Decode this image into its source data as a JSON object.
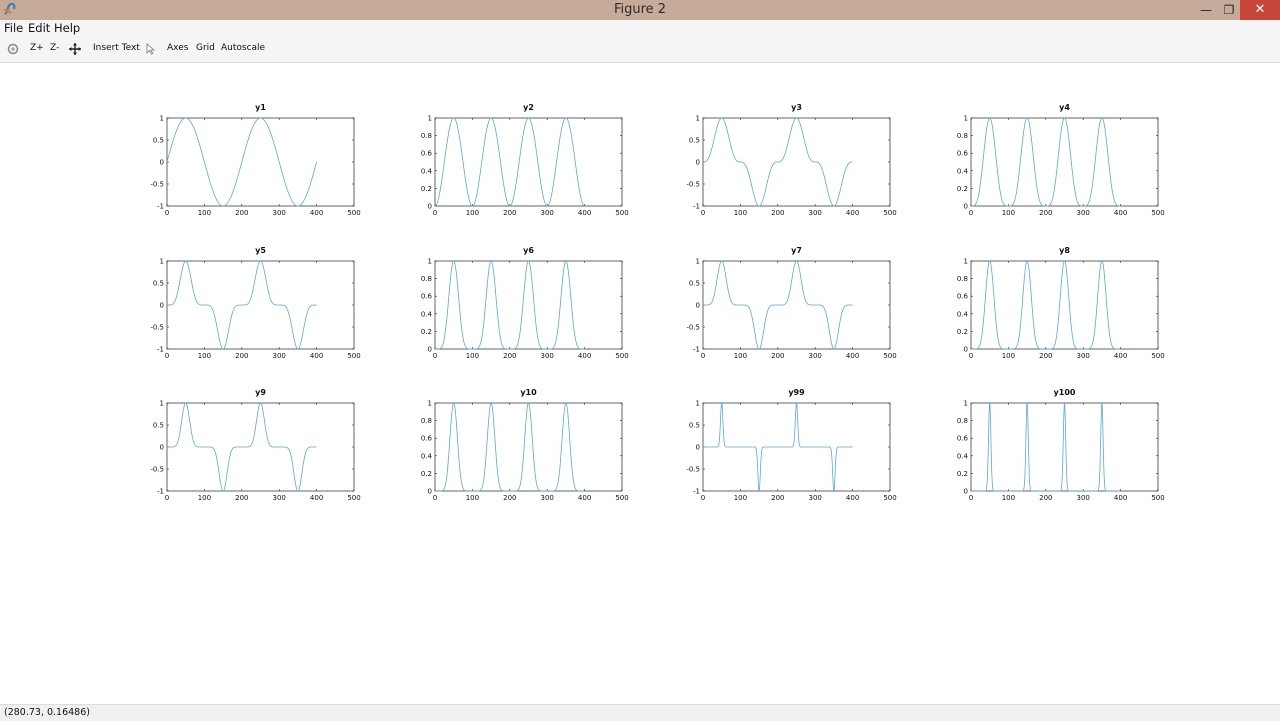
{
  "window": {
    "title": "Figure 2",
    "minimize_icon": "minimize-icon",
    "maximize_icon": "maximize-icon",
    "close_icon": "close-icon"
  },
  "menu": {
    "items": [
      "File",
      "Edit",
      "Help"
    ]
  },
  "toolbar": {
    "zoom_in": "Z+",
    "zoom_out": "Z-",
    "insert_text": "Insert Text",
    "axes": "Axes",
    "grid": "Grid",
    "autoscale": "Autoscale"
  },
  "status": {
    "coordinates": "(280.73, 0.16486)"
  },
  "colors": {
    "line": "#5aa9d6",
    "titlebar": "#c6ab9a",
    "close": "#c7453b"
  },
  "chart_data": [
    {
      "type": "line",
      "title": "y1",
      "series": [
        {
          "x": [
            0,
            400
          ],
          "function": "sin(2*pi*x/200)"
        }
      ],
      "xlim": [
        0,
        500
      ],
      "ylim": [
        -1,
        1
      ],
      "xticks": [
        0,
        100,
        200,
        300,
        400,
        500
      ],
      "yticks": [
        -1,
        -0.5,
        0,
        0.5,
        1
      ]
    },
    {
      "type": "line",
      "title": "y2",
      "series": [
        {
          "x": [
            0,
            400
          ],
          "function": "sin(2*pi*x/200)^2"
        }
      ],
      "xlim": [
        0,
        500
      ],
      "ylim": [
        0,
        1
      ],
      "xticks": [
        0,
        100,
        200,
        300,
        400,
        500
      ],
      "yticks": [
        0,
        0.2,
        0.4,
        0.6,
        0.8,
        1
      ]
    },
    {
      "type": "line",
      "title": "y3",
      "series": [
        {
          "x": [
            0,
            400
          ],
          "function": "sin(2*pi*x/200)^3"
        }
      ],
      "xlim": [
        0,
        500
      ],
      "ylim": [
        -1,
        1
      ],
      "xticks": [
        0,
        100,
        200,
        300,
        400,
        500
      ],
      "yticks": [
        -1,
        -0.5,
        0,
        0.5,
        1
      ]
    },
    {
      "type": "line",
      "title": "y4",
      "series": [
        {
          "x": [
            0,
            400
          ],
          "function": "sin(2*pi*x/200)^4"
        }
      ],
      "xlim": [
        0,
        500
      ],
      "ylim": [
        0,
        1
      ],
      "xticks": [
        0,
        100,
        200,
        300,
        400,
        500
      ],
      "yticks": [
        0,
        0.2,
        0.4,
        0.6,
        0.8,
        1
      ]
    },
    {
      "type": "line",
      "title": "y5",
      "series": [
        {
          "x": [
            0,
            400
          ],
          "function": "sin(2*pi*x/200)^5"
        }
      ],
      "xlim": [
        0,
        500
      ],
      "ylim": [
        -1,
        1
      ],
      "xticks": [
        0,
        100,
        200,
        300,
        400,
        500
      ],
      "yticks": [
        -1,
        -0.5,
        0,
        0.5,
        1
      ]
    },
    {
      "type": "line",
      "title": "y6",
      "series": [
        {
          "x": [
            0,
            400
          ],
          "function": "sin(2*pi*x/200)^6"
        }
      ],
      "xlim": [
        0,
        500
      ],
      "ylim": [
        0,
        1
      ],
      "xticks": [
        0,
        100,
        200,
        300,
        400,
        500
      ],
      "yticks": [
        0,
        0.2,
        0.4,
        0.6,
        0.8,
        1
      ]
    },
    {
      "type": "line",
      "title": "y7",
      "series": [
        {
          "x": [
            0,
            400
          ],
          "function": "sin(2*pi*x/200)^7"
        }
      ],
      "xlim": [
        0,
        500
      ],
      "ylim": [
        -1,
        1
      ],
      "xticks": [
        0,
        100,
        200,
        300,
        400,
        500
      ],
      "yticks": [
        -1,
        -0.5,
        0,
        0.5,
        1
      ]
    },
    {
      "type": "line",
      "title": "y8",
      "series": [
        {
          "x": [
            0,
            400
          ],
          "function": "sin(2*pi*x/200)^8"
        }
      ],
      "xlim": [
        0,
        500
      ],
      "ylim": [
        0,
        1
      ],
      "xticks": [
        0,
        100,
        200,
        300,
        400,
        500
      ],
      "yticks": [
        0,
        0.2,
        0.4,
        0.6,
        0.8,
        1
      ]
    },
    {
      "type": "line",
      "title": "y9",
      "series": [
        {
          "x": [
            0,
            400
          ],
          "function": "sin(2*pi*x/200)^9"
        }
      ],
      "xlim": [
        0,
        500
      ],
      "ylim": [
        -1,
        1
      ],
      "xticks": [
        0,
        100,
        200,
        300,
        400,
        500
      ],
      "yticks": [
        -1,
        -0.5,
        0,
        0.5,
        1
      ]
    },
    {
      "type": "line",
      "title": "y10",
      "series": [
        {
          "x": [
            0,
            400
          ],
          "function": "sin(2*pi*x/200)^10"
        }
      ],
      "xlim": [
        0,
        500
      ],
      "ylim": [
        0,
        1
      ],
      "xticks": [
        0,
        100,
        200,
        300,
        400,
        500
      ],
      "yticks": [
        0,
        0.2,
        0.4,
        0.6,
        0.8,
        1
      ]
    },
    {
      "type": "line",
      "title": "y99",
      "series": [
        {
          "x": [
            0,
            400
          ],
          "function": "sin(2*pi*x/200)^99"
        }
      ],
      "xlim": [
        0,
        500
      ],
      "ylim": [
        -1,
        1
      ],
      "xticks": [
        0,
        100,
        200,
        300,
        400,
        500
      ],
      "yticks": [
        -1,
        -0.5,
        0,
        0.5,
        1
      ]
    },
    {
      "type": "line",
      "title": "y100",
      "series": [
        {
          "x": [
            0,
            400
          ],
          "function": "sin(2*pi*x/200)^100"
        }
      ],
      "xlim": [
        0,
        500
      ],
      "ylim": [
        0,
        1
      ],
      "xticks": [
        0,
        100,
        200,
        300,
        400,
        500
      ],
      "yticks": [
        0,
        0.2,
        0.4,
        0.6,
        0.8,
        1
      ]
    }
  ]
}
